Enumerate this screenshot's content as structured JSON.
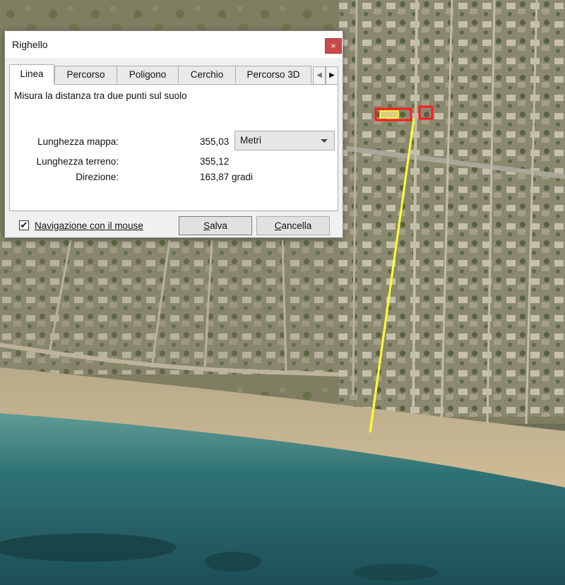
{
  "dialog": {
    "title": "Righello",
    "close_glyph": "×",
    "tabs": [
      {
        "label": "Linea",
        "active": true
      },
      {
        "label": "Percorso",
        "active": false
      },
      {
        "label": "Poligono",
        "active": false
      },
      {
        "label": "Cerchio",
        "active": false
      },
      {
        "label": "Percorso 3D",
        "active": false
      }
    ],
    "tab_scroll_left_glyph": "◀",
    "tab_scroll_right_glyph": "▶",
    "description": "Misura la distanza tra due punti sul suolo",
    "map_length": {
      "label": "Lunghezza mappa:",
      "value": "355,03"
    },
    "unit": {
      "selected": "Metri"
    },
    "ground_length": {
      "label": "Lunghezza terreno:",
      "value": "355,12"
    },
    "direction": {
      "label": "Direzione:",
      "value": "163,87 gradi"
    },
    "mouse_navigation": {
      "label": "Navigazione con il mouse",
      "checked": true,
      "check_glyph": "✔"
    },
    "save_button": {
      "label": "Salva",
      "mnemonic": "S",
      "rest": "alva"
    },
    "cancel_button": {
      "label": "Cancella",
      "mnemonic": "C",
      "rest": "ancella"
    }
  },
  "map": {
    "measure_line_color": "#ffff33",
    "marker_color": "#ff1a1a",
    "sea_color": "#2e6b72",
    "beach_color": "#c9b48e",
    "land_color": "#8a8a6a"
  }
}
